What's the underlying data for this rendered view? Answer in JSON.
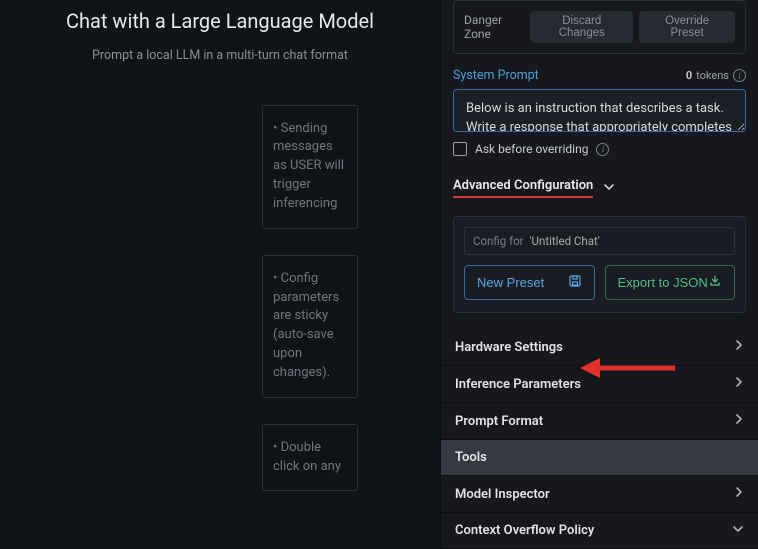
{
  "left": {
    "title": "Chat with a Large Language Model",
    "subtitle": "Prompt a local LLM in a multi-turn chat format",
    "tips": [
      "• Sending messages as USER will trigger inferencing",
      "• Config parameters are sticky (auto-save upon changes).",
      "• Double click on any"
    ]
  },
  "danger": {
    "label": "Danger Zone",
    "discard": "Discard Changes",
    "override": "Override Preset"
  },
  "systemPrompt": {
    "label": "System Prompt",
    "tokensCount": "0",
    "tokensLabel": "tokens",
    "text": "Below is an instruction that describes a task. Write a response that appropriately completes the request.",
    "askLabel": "Ask before overriding"
  },
  "advanced": {
    "title": "Advanced Configuration",
    "configForLabel": "Config for",
    "chatName": "'Untitled Chat'",
    "newPreset": "New Preset",
    "exportJson": "Export to JSON"
  },
  "sections": {
    "hardware": "Hardware Settings",
    "inference": "Inference Parameters",
    "promptFormat": "Prompt Format",
    "tools": "Tools",
    "modelInspector": "Model Inspector",
    "contextOverflow": "Context Overflow Policy"
  }
}
